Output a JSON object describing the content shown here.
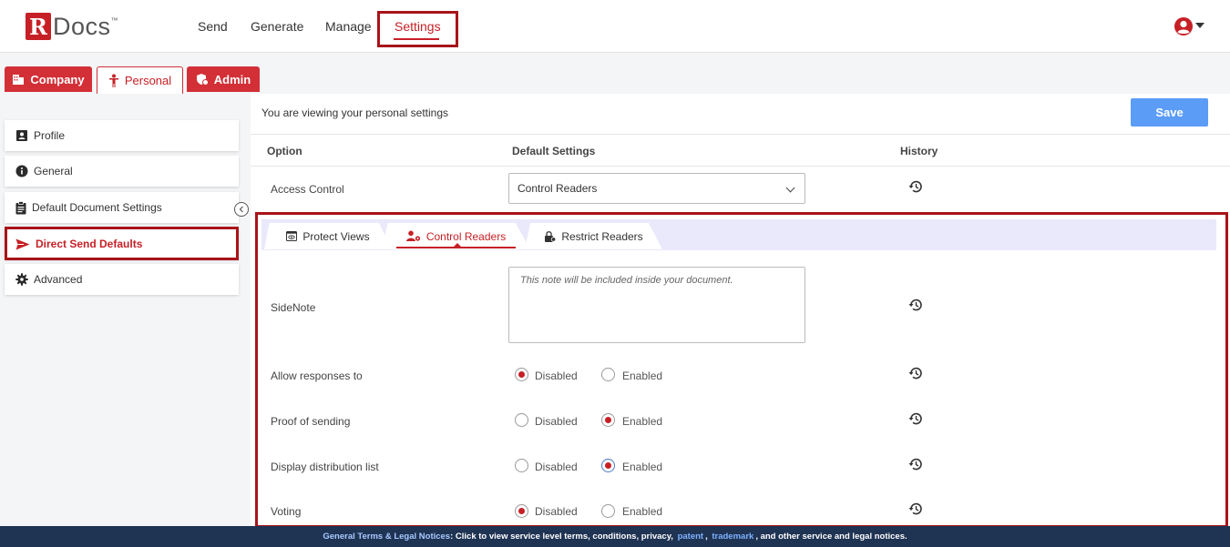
{
  "app": {
    "logo_r": "R",
    "logo_docs": "Docs",
    "logo_tm": "™"
  },
  "nav": {
    "send": "Send",
    "generate": "Generate",
    "manage": "Manage",
    "settings": "Settings"
  },
  "category_tabs": {
    "company": "Company",
    "personal": "Personal",
    "admin": "Admin"
  },
  "sidebar": {
    "items": [
      {
        "label": "Profile",
        "icon": "profile-card-icon"
      },
      {
        "label": "General",
        "icon": "info-icon"
      },
      {
        "label": "Default Document Settings",
        "icon": "clipboard-icon"
      },
      {
        "label": "Direct Send Defaults",
        "icon": "send-plane-icon",
        "active": true
      },
      {
        "label": "Advanced",
        "icon": "gear-icon"
      }
    ]
  },
  "main": {
    "viewing_text": "You are viewing your personal settings",
    "save_label": "Save",
    "columns": {
      "option": "Option",
      "default_settings": "Default Settings",
      "history": "History"
    },
    "access_control": {
      "label": "Access Control",
      "value": "Control Readers"
    }
  },
  "sub_tabs": {
    "protect_views": "Protect Views",
    "control_readers": "Control Readers",
    "restrict_readers": "Restrict Readers",
    "active": "Control Readers"
  },
  "settings": {
    "sidenote": {
      "label": "SideNote",
      "placeholder": "This note will be included inside your document."
    },
    "rows": [
      {
        "label": "Allow responses to",
        "disabled_label": "Disabled",
        "enabled_label": "Enabled",
        "selected": "Disabled"
      },
      {
        "label": "Proof of sending",
        "disabled_label": "Disabled",
        "enabled_label": "Enabled",
        "selected": "Enabled"
      },
      {
        "label": "Display distribution list",
        "disabled_label": "Disabled",
        "enabled_label": "Enabled",
        "selected": "Enabled"
      },
      {
        "label": "Voting",
        "disabled_label": "Disabled",
        "enabled_label": "Enabled",
        "selected": "Disabled"
      }
    ]
  },
  "footer": {
    "lead": "General Terms & Legal Notices",
    "text1": ": Click to view service level terms, conditions, privacy, ",
    "patent": "patent",
    "sep": ", ",
    "trademark": "trademark",
    "text2": ", and other service and legal notices."
  },
  "colors": {
    "brand_red": "#c62026",
    "save_blue": "#5b9cf6",
    "footer_navy": "#1f3353",
    "subtab_bg": "#e9e9fb"
  }
}
